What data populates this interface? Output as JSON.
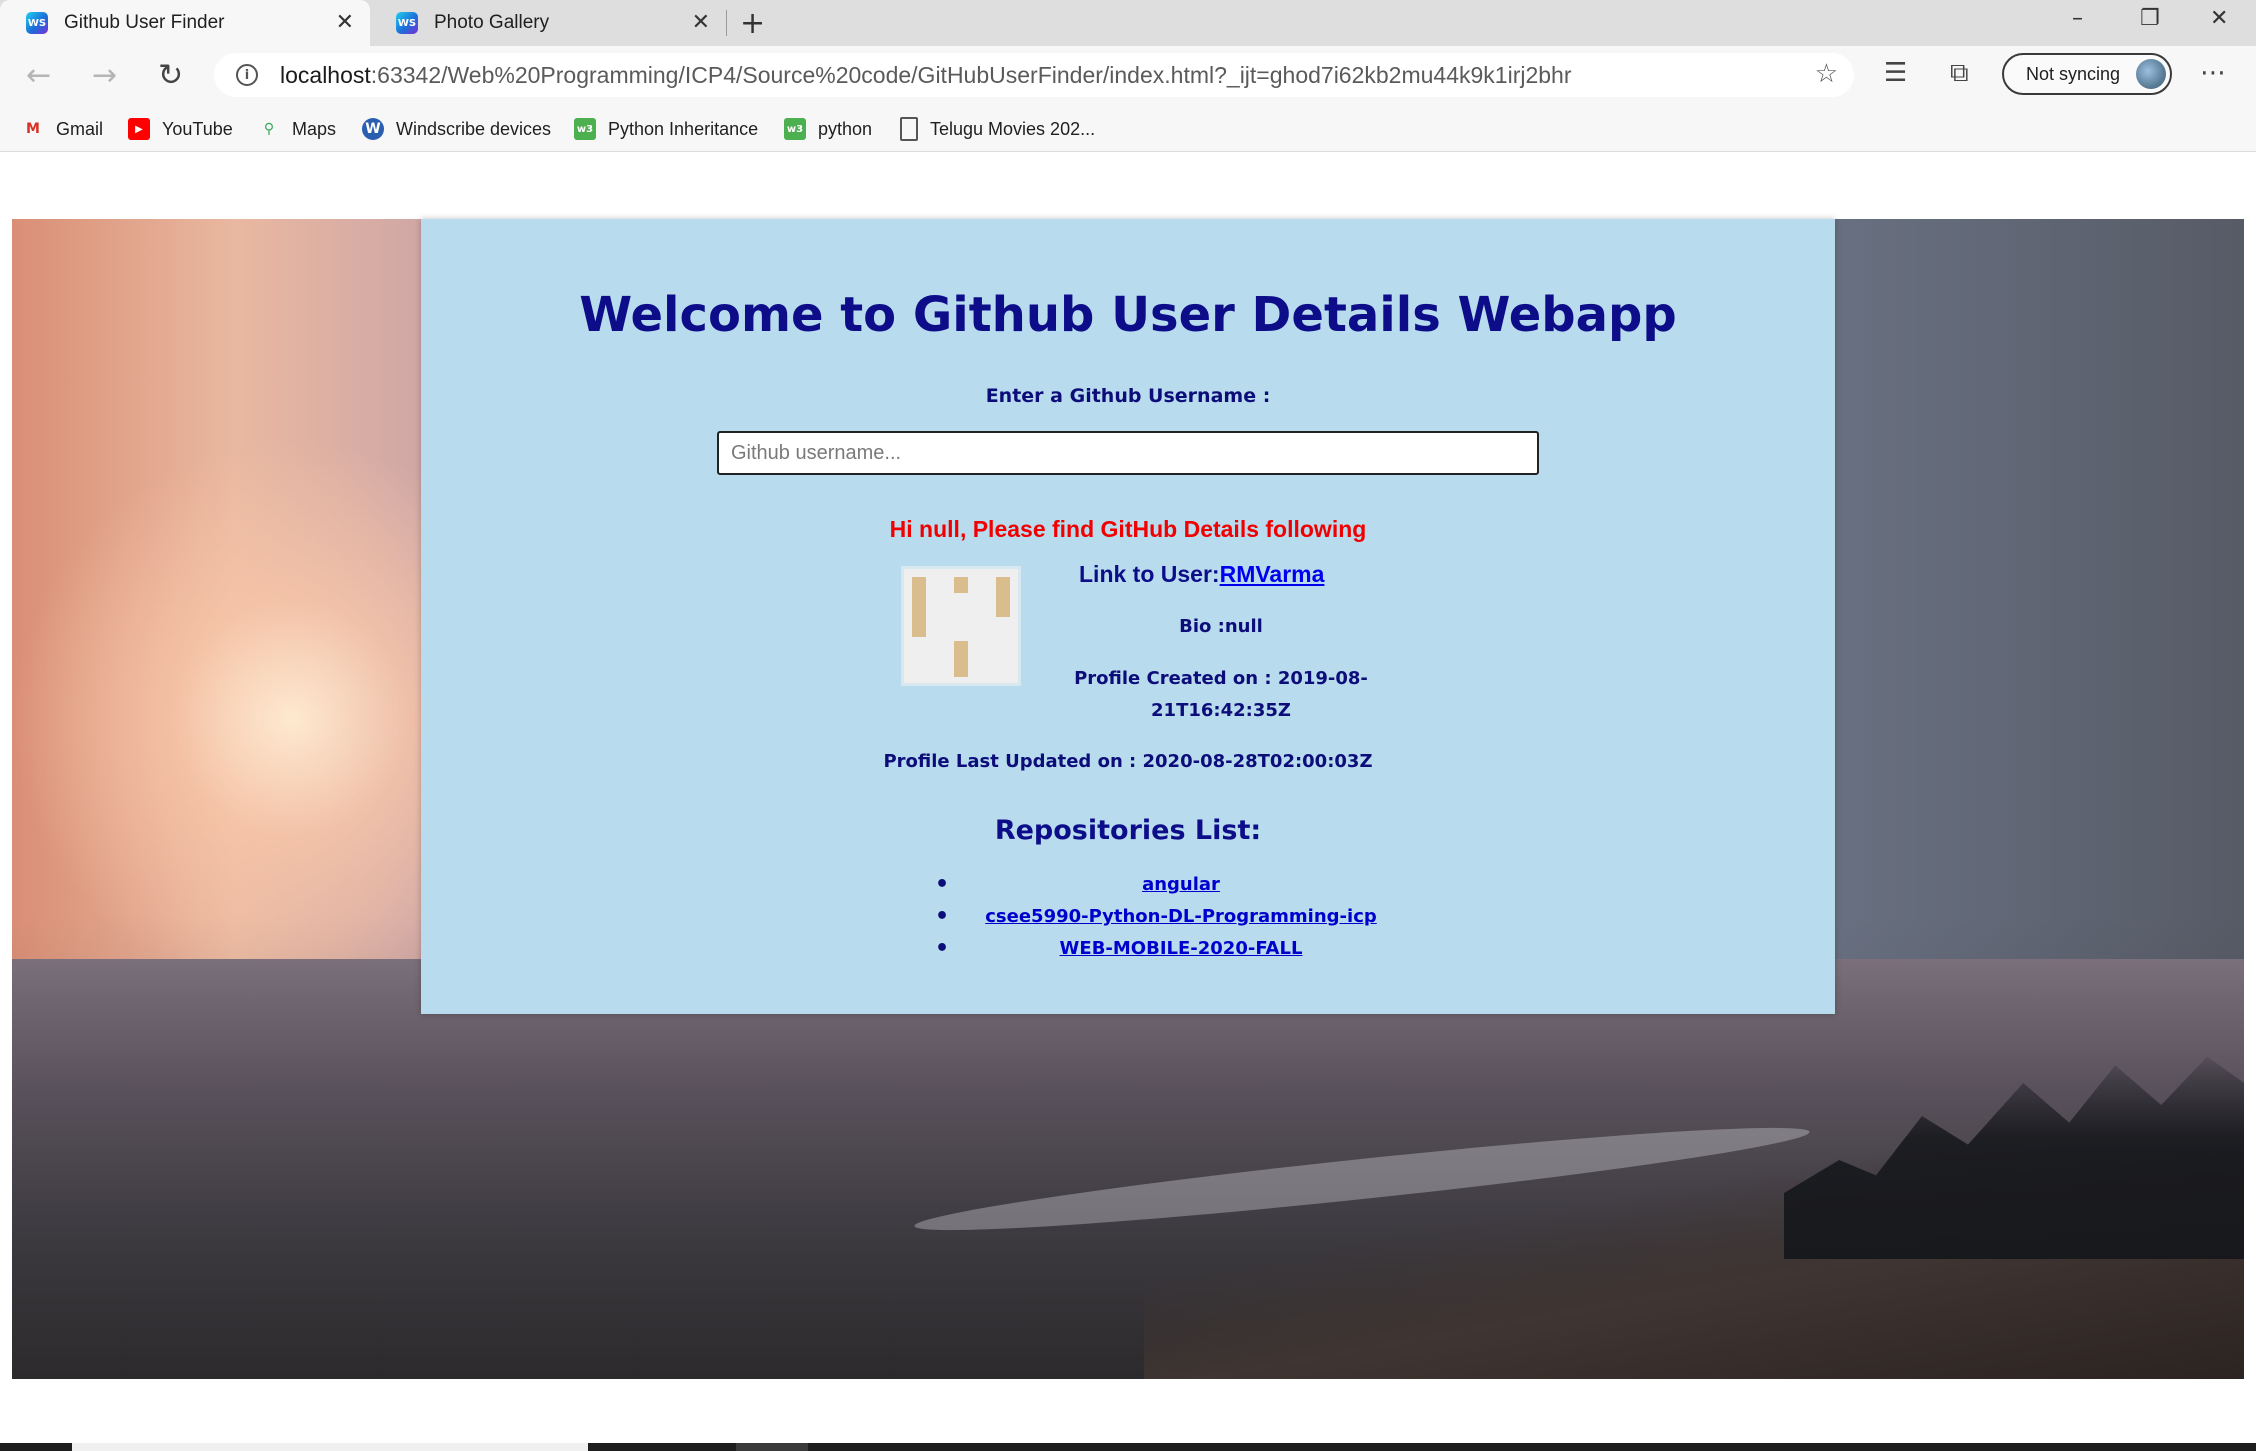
{
  "browser": {
    "tabs": [
      {
        "title": "Github User Finder",
        "active": true
      },
      {
        "title": "Photo Gallery",
        "active": false
      }
    ],
    "favicon_text": "WS",
    "url_host": "localhost",
    "url_rest": ":63342/Web%20Programming/ICP4/Source%20code/GitHubUserFinder/index.html?_ijt=ghod7i62kb2mu44k9k1irj2bhr",
    "sync_label": "Not syncing",
    "bookmarks": [
      {
        "label": "Gmail",
        "icon": "gmail-icon",
        "color": "#d93025"
      },
      {
        "label": "YouTube",
        "icon": "youtube-icon",
        "color": "#ff0000"
      },
      {
        "label": "Maps",
        "icon": "maps-icon",
        "color": "#34a853"
      },
      {
        "label": "Windscribe devices",
        "icon": "windscribe-icon",
        "color": "#2a5fb0"
      },
      {
        "label": "Python Inheritance",
        "icon": "w3schools-icon",
        "color": "#4caf50"
      },
      {
        "label": "python",
        "icon": "w3schools-icon",
        "color": "#4caf50"
      },
      {
        "label": "Telugu Movies 202...",
        "icon": "page-icon",
        "color": "#555555"
      }
    ]
  },
  "page": {
    "title": "Welcome to Github User Details Webapp",
    "prompt": "Enter a Github Username :",
    "search_placeholder": "Github username...",
    "greeting": "Hi null, Please find GitHub Details following",
    "link_label": "Link to User:",
    "username": "RMVarma",
    "bio": "Bio :null",
    "created": "Profile Created on : 2019-08-21T16:42:35Z",
    "updated": "Profile Last Updated on : 2020-08-28T02:00:03Z",
    "repos_heading": "Repositories List:",
    "repos": [
      "angular",
      "csee5990-Python-DL-Programming-icp",
      "WEB-MOBILE-2020-FALL"
    ]
  },
  "colors": {
    "panel_bg": "#b8dcee",
    "heading": "#0d0d8a",
    "greeting": "#f00000",
    "link": "#0000ee"
  }
}
